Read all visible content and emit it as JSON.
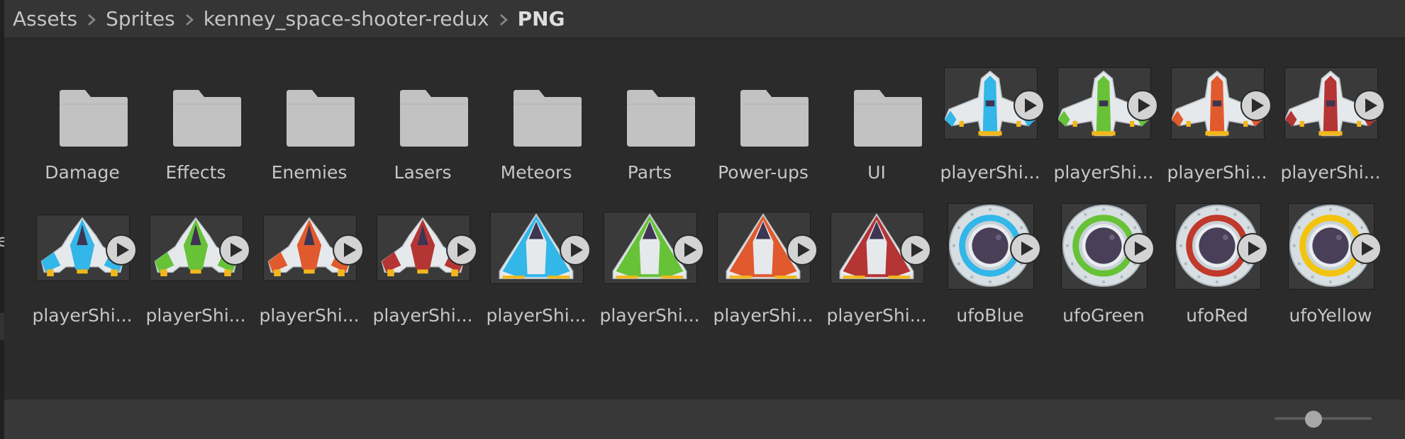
{
  "breadcrumb": [
    {
      "label": "Assets",
      "current": false
    },
    {
      "label": "Sprites",
      "current": false
    },
    {
      "label": "kenney_space-shooter-redux",
      "current": false
    },
    {
      "label": "PNG",
      "current": true
    }
  ],
  "assets": [
    {
      "name": "Damage",
      "kind": "folder"
    },
    {
      "name": "Effects",
      "kind": "folder"
    },
    {
      "name": "Enemies",
      "kind": "folder"
    },
    {
      "name": "Lasers",
      "kind": "folder"
    },
    {
      "name": "Meteors",
      "kind": "folder"
    },
    {
      "name": "Parts",
      "kind": "folder"
    },
    {
      "name": "Power-ups",
      "kind": "folder"
    },
    {
      "name": "UI",
      "kind": "folder"
    },
    {
      "name": "playerShi...",
      "kind": "sprite",
      "shape": "ship1",
      "color": "#33b6e8"
    },
    {
      "name": "playerShi...",
      "kind": "sprite",
      "shape": "ship1",
      "color": "#67c238"
    },
    {
      "name": "playerShi...",
      "kind": "sprite",
      "shape": "ship1",
      "color": "#e05a2e"
    },
    {
      "name": "playerShi...",
      "kind": "sprite",
      "shape": "ship1",
      "color": "#b53535"
    },
    {
      "name": "playerShi...",
      "kind": "sprite",
      "shape": "ship2",
      "color": "#33b6e8"
    },
    {
      "name": "playerShi...",
      "kind": "sprite",
      "shape": "ship2",
      "color": "#67c238"
    },
    {
      "name": "playerShi...",
      "kind": "sprite",
      "shape": "ship2",
      "color": "#e05a2e"
    },
    {
      "name": "playerShi...",
      "kind": "sprite",
      "shape": "ship2",
      "color": "#b53535"
    },
    {
      "name": "playerShi...",
      "kind": "sprite",
      "shape": "ship3",
      "color": "#33b6e8"
    },
    {
      "name": "playerShi...",
      "kind": "sprite",
      "shape": "ship3",
      "color": "#67c238"
    },
    {
      "name": "playerShi...",
      "kind": "sprite",
      "shape": "ship3",
      "color": "#e05a2e"
    },
    {
      "name": "playerShi...",
      "kind": "sprite",
      "shape": "ship3",
      "color": "#b53535"
    },
    {
      "name": "ufoBlue",
      "kind": "sprite",
      "shape": "ufo",
      "color": "#33b6e8"
    },
    {
      "name": "ufoGreen",
      "kind": "sprite",
      "shape": "ufo",
      "color": "#67c238"
    },
    {
      "name": "ufoRed",
      "kind": "sprite",
      "shape": "ufo",
      "color": "#c0392b"
    },
    {
      "name": "ufoYellow",
      "kind": "sprite",
      "shape": "ufo",
      "color": "#f2c40f"
    }
  ],
  "zoom_slider": {
    "level": 0.4
  }
}
